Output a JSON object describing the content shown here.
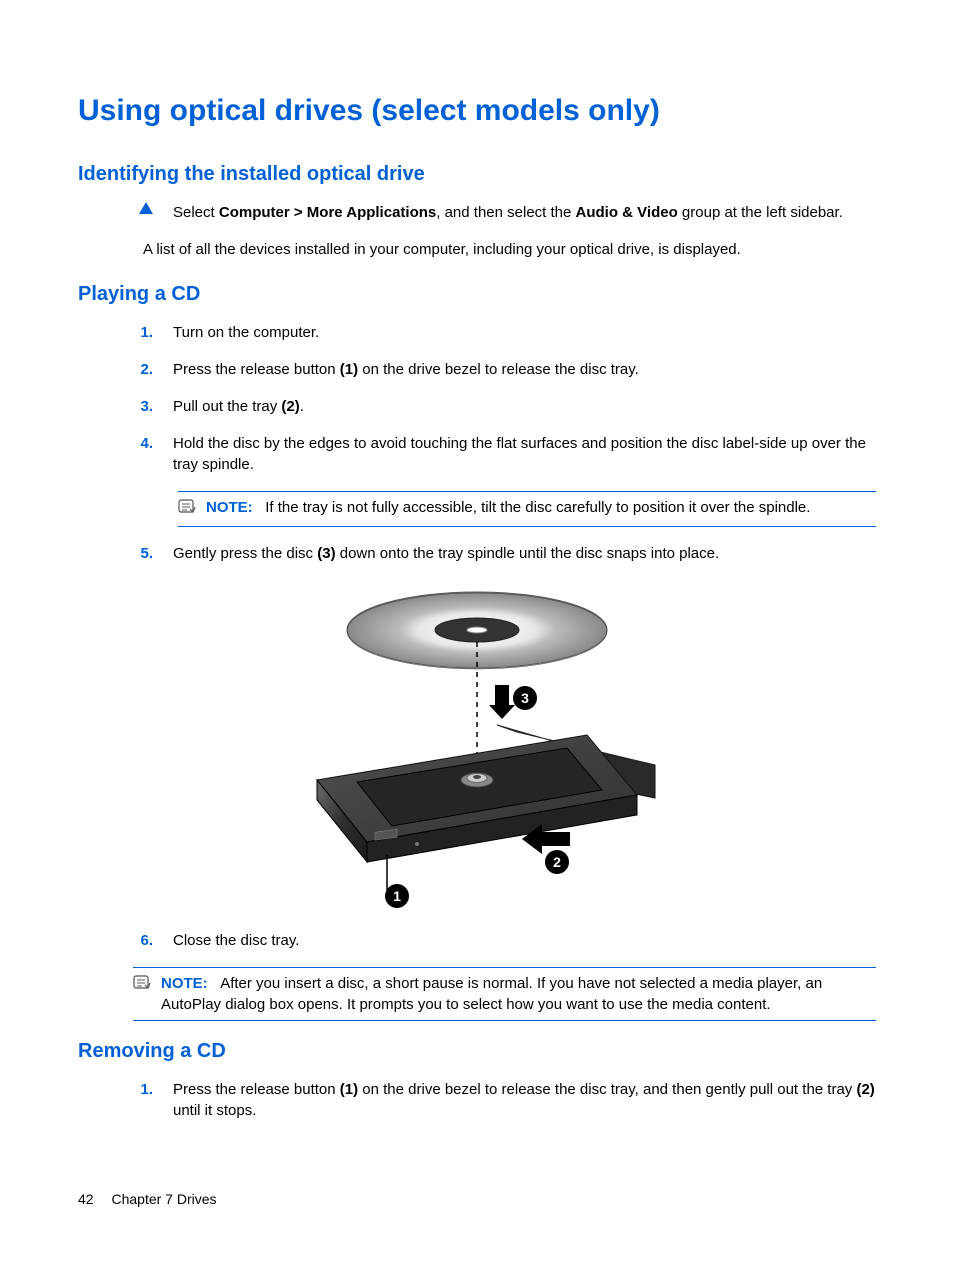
{
  "h1": "Using optical drives (select models only)",
  "sections": {
    "identifying": {
      "heading": "Identifying the installed optical drive",
      "step_pre": "Select ",
      "step_bold1": "Computer > More Applications",
      "step_mid": ", and then select the ",
      "step_bold2": "Audio & Video",
      "step_post": " group at the left sidebar.",
      "para": "A list of all the devices installed in your computer, including your optical drive, is displayed."
    },
    "playing": {
      "heading": "Playing a CD",
      "steps": {
        "n1": "1.",
        "t1": "Turn on the computer.",
        "n2": "2.",
        "t2_pre": "Press the release button ",
        "t2_b": "(1)",
        "t2_post": " on the drive bezel to release the disc tray.",
        "n3": "3.",
        "t3_pre": "Pull out the tray ",
        "t3_b": "(2)",
        "t3_post": ".",
        "n4": "4.",
        "t4": "Hold the disc by the edges to avoid touching the flat surfaces and position the disc label-side up over the tray spindle.",
        "n5": "5.",
        "t5_pre": "Gently press the disc ",
        "t5_b": "(3)",
        "t5_post": " down onto the tray spindle until the disc snaps into place.",
        "n6": "6.",
        "t6": "Close the disc tray."
      },
      "note1_label": "NOTE:",
      "note1_text": "If the tray is not fully accessible, tilt the disc carefully to position it over the spindle.",
      "note2_label": "NOTE:",
      "note2_text": "After you insert a disc, a short pause is normal. If you have not selected a media player, an AutoPlay dialog box opens. It prompts you to select how you want to use the media content."
    },
    "removing": {
      "heading": "Removing a CD",
      "n1": "1.",
      "t1_pre": "Press the release button ",
      "t1_b1": "(1)",
      "t1_mid": " on the drive bezel to release the disc tray, and then gently pull out the tray ",
      "t1_b2": "(2)",
      "t1_post": " until it stops."
    }
  },
  "callouts": {
    "c1": "1",
    "c2": "2",
    "c3": "3"
  },
  "footer": {
    "page": "42",
    "chapter": "Chapter 7   Drives"
  }
}
